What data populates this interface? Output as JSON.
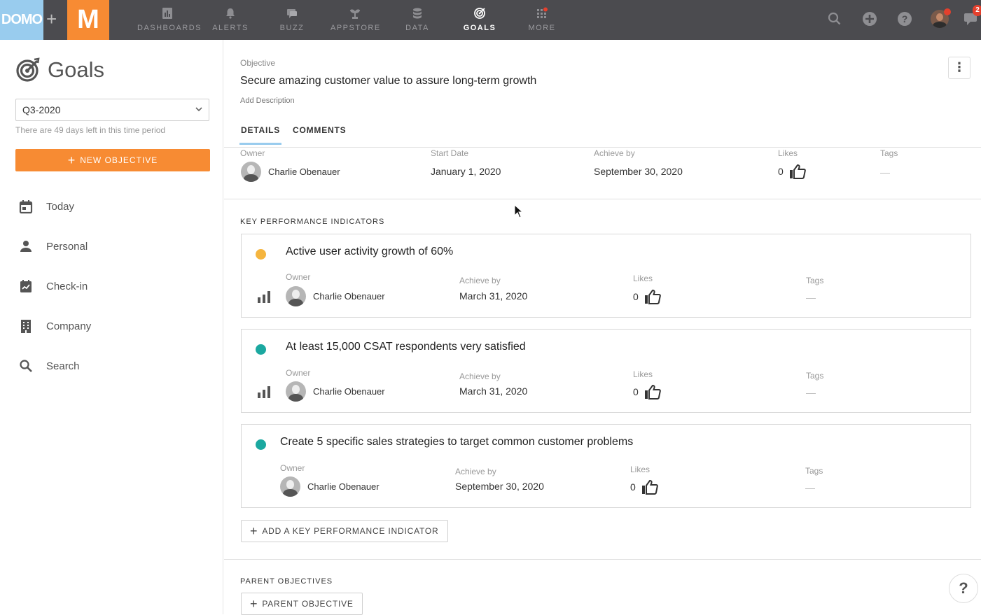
{
  "topbar": {
    "logo_domo": "DOMO",
    "logo_plus": "+",
    "logo_m": "M",
    "nav": [
      {
        "label": "DASHBOARDS",
        "icon": "dashboards-icon"
      },
      {
        "label": "ALERTS",
        "icon": "bell-icon"
      },
      {
        "label": "BUZZ",
        "icon": "chat-icon"
      },
      {
        "label": "APPSTORE",
        "icon": "appstore-icon"
      },
      {
        "label": "DATA",
        "icon": "database-icon"
      },
      {
        "label": "GOALS",
        "icon": "target-icon",
        "active": true
      },
      {
        "label": "MORE",
        "icon": "grid-icon"
      }
    ],
    "badge_count": "2",
    "accent_orange": "#f78b33",
    "accent_blue": "#99ccee"
  },
  "sidebar": {
    "title": "Goals",
    "period": "Q3-2020",
    "days_left": "There are 49 days left in this time period",
    "new_objective": "NEW OBJECTIVE",
    "items": [
      {
        "label": "Today",
        "icon": "calendar-icon"
      },
      {
        "label": "Personal",
        "icon": "person-icon"
      },
      {
        "label": "Check-in",
        "icon": "checkin-icon"
      },
      {
        "label": "Company",
        "icon": "building-icon"
      },
      {
        "label": "Search",
        "icon": "search-icon"
      }
    ]
  },
  "objective": {
    "label": "Objective",
    "title": "Secure amazing customer value to assure long-term growth",
    "add_description": "Add Description",
    "more_menu": "⋮",
    "tabs": [
      {
        "label": "DETAILS",
        "active": true
      },
      {
        "label": "COMMENTS"
      }
    ],
    "meta": {
      "owner_label": "Owner",
      "owner_name": "Charlie Obenauer",
      "start_label": "Start Date",
      "start_value": "January 1, 2020",
      "achieve_label": "Achieve by",
      "achieve_value": "September 30, 2020",
      "likes_label": "Likes",
      "likes_value": "0",
      "tags_label": "Tags",
      "tags_value": "—"
    }
  },
  "kpis": {
    "heading": "KEY PERFORMANCE INDICATORS",
    "items": [
      {
        "title": "Active user activity growth of 60%",
        "status_color": "#f5b53f",
        "owner_label": "Owner",
        "owner": "Charlie Obenauer",
        "achieve_label": "Achieve by",
        "achieve": "March 31, 2020",
        "likes_label": "Likes",
        "likes": "0",
        "tags_label": "Tags",
        "tags": "—"
      },
      {
        "title": "At least 15,000 CSAT respondents very satisfied",
        "status_color": "#1ba8a0",
        "owner_label": "Owner",
        "owner": "Charlie Obenauer",
        "achieve_label": "Achieve by",
        "achieve": "March 31, 2020",
        "likes_label": "Likes",
        "likes": "0",
        "tags_label": "Tags",
        "tags": "—"
      },
      {
        "title": "Create 5 specific sales strategies to target common customer problems",
        "status_color": "#1ba8a0",
        "owner_label": "Owner",
        "owner": "Charlie Obenauer",
        "achieve_label": "Achieve by",
        "achieve": "September 30, 2020",
        "likes_label": "Likes",
        "likes": "0",
        "tags_label": "Tags",
        "tags": "—"
      }
    ],
    "add_button": "ADD A KEY PERFORMANCE INDICATOR"
  },
  "parents": {
    "heading": "PARENT OBJECTIVES",
    "add_button": "PARENT OBJECTIVE"
  },
  "help": "?"
}
